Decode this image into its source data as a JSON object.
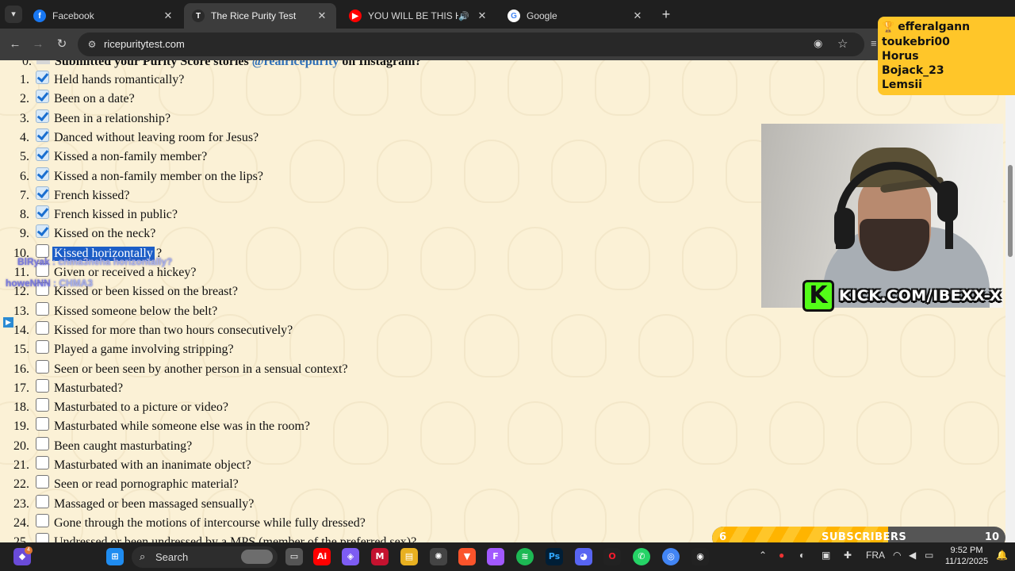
{
  "browser": {
    "tabs": [
      {
        "title": "Facebook",
        "favicon": "facebook-icon",
        "color": "#1877f2",
        "glyph": "f",
        "active": false
      },
      {
        "title": "The Rice Purity Test",
        "favicon": "rice-purity-icon",
        "color": "#2a2a2a",
        "glyph": "T",
        "active": true
      },
      {
        "title": "YOU WILL BE THIS HERO | (",
        "favicon": "youtube-icon",
        "color": "#ff0000",
        "glyph": "▶",
        "active": false
      },
      {
        "title": "Google",
        "favicon": "google-icon",
        "color": "#ffffff",
        "glyph": "G",
        "active": false
      }
    ],
    "close_glyph": "✕",
    "new_tab_glyph": "+",
    "url": "ricepuritytest.com"
  },
  "page": {
    "header": {
      "number": "0.",
      "text_before": "Submitted your Purity Score stories ",
      "handle": "@realricepurity",
      "text_after": " on Instagram?"
    },
    "questions": [
      {
        "n": "1.",
        "text": "Held hands romantically?",
        "checked": true
      },
      {
        "n": "2.",
        "text": "Been on a date?",
        "checked": true
      },
      {
        "n": "3.",
        "text": "Been in a relationship?",
        "checked": true
      },
      {
        "n": "4.",
        "text": "Danced without leaving room for Jesus?",
        "checked": true
      },
      {
        "n": "5.",
        "text": "Kissed a non-family member?",
        "checked": true
      },
      {
        "n": "6.",
        "text": "Kissed a non-family member on the lips?",
        "checked": true
      },
      {
        "n": "7.",
        "text": "French kissed?",
        "checked": true
      },
      {
        "n": "8.",
        "text": "French kissed in public?",
        "checked": true
      },
      {
        "n": "9.",
        "text": "Kissed on the neck?",
        "checked": true
      },
      {
        "n": "10.",
        "text": "Kissed horizontally",
        "trail": "?",
        "checked": false,
        "selected": true
      },
      {
        "n": "11.",
        "text": "Given or received a hickey?",
        "checked": false
      },
      {
        "n": "12.",
        "text": "Kissed or been kissed on the breast?",
        "checked": false
      },
      {
        "n": "13.",
        "text": "Kissed someone below the belt?",
        "checked": false
      },
      {
        "n": "14.",
        "text": "Kissed for more than two hours consecutively?",
        "checked": false
      },
      {
        "n": "15.",
        "text": "Played a game involving stripping?",
        "checked": false
      },
      {
        "n": "16.",
        "text": "Seen or been seen by another person in a sensual context?",
        "checked": false
      },
      {
        "n": "17.",
        "text": "Masturbated?",
        "checked": false
      },
      {
        "n": "18.",
        "text": "Masturbated to a picture or video?",
        "checked": false
      },
      {
        "n": "19.",
        "text": "Masturbated while someone else was in the room?",
        "checked": false
      },
      {
        "n": "20.",
        "text": "Been caught masturbating?",
        "checked": false
      },
      {
        "n": "21.",
        "text": "Masturbated with an inanimate object?",
        "checked": false
      },
      {
        "n": "22.",
        "text": "Seen or read pornographic material?",
        "checked": false
      },
      {
        "n": "23.",
        "text": "Massaged or been massaged sensually?",
        "checked": false
      },
      {
        "n": "24.",
        "text": "Gone through the motions of intercourse while fully dressed?",
        "checked": false
      },
      {
        "n": "25.",
        "text": "Undressed or been undressed by a MPS (member of the preferred sex)?",
        "checked": false
      }
    ]
  },
  "stream_chat": [
    {
      "user": "BlRyak",
      "message": "chma3neha horizontally?"
    },
    {
      "user": "howeNNN",
      "message": "CHMA3"
    }
  ],
  "viewers_panel": {
    "names": [
      "efferalgann",
      "toukebri00",
      "Horus",
      "Bojack_23",
      "Lemsii"
    ]
  },
  "kick_banner": {
    "url": "KICK.COM/IBEXX-X",
    "logo_letter": "K",
    "color": "#53fc18"
  },
  "subscriber_goal": {
    "label": "SUBSCRIBERS",
    "current": "6",
    "goal": "10",
    "progress_fraction": 0.6
  },
  "taskbar": {
    "search_placeholder": "Search",
    "language": "FRA",
    "time": "9:52 PM",
    "date": "11/12/2025"
  }
}
